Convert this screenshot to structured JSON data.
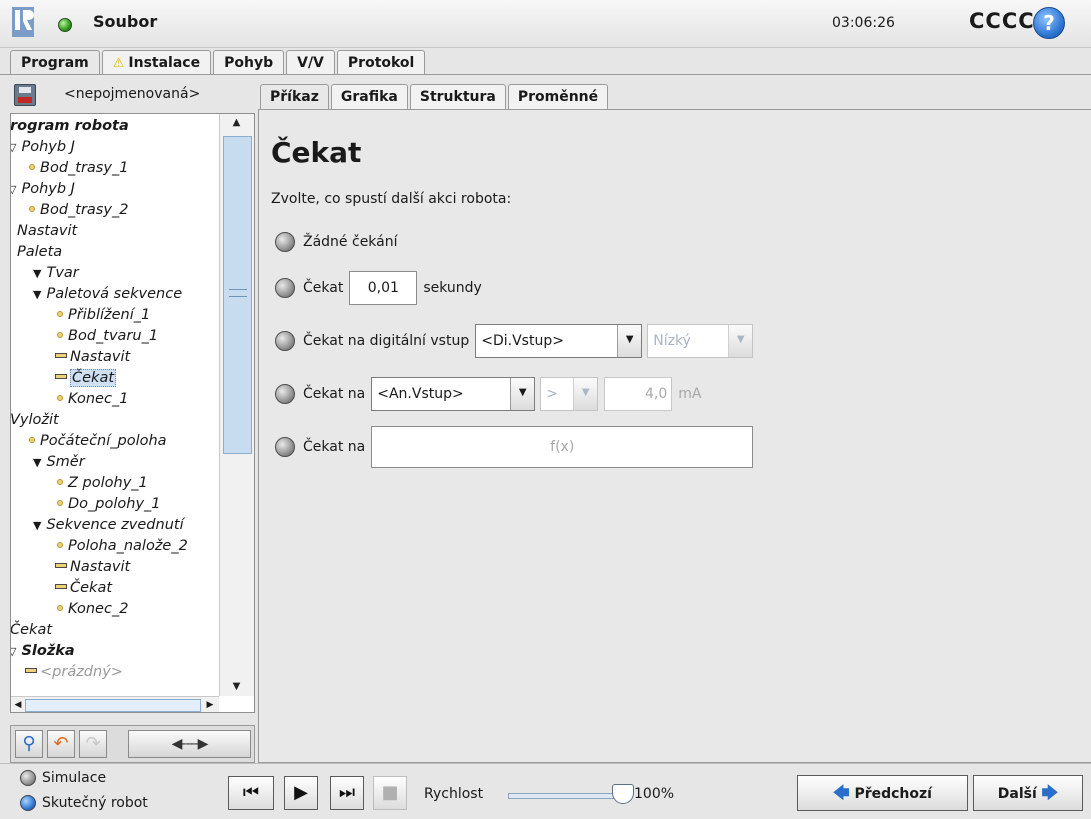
{
  "titlebar": {
    "file_menu": "Soubor",
    "clock": "03:06:26",
    "robot_name": "CCCC",
    "help": "?"
  },
  "top_tabs": [
    {
      "label": "Program"
    },
    {
      "label": "Instalace"
    },
    {
      "label": "Pohyb"
    },
    {
      "label": "V/V"
    },
    {
      "label": "Protokol"
    }
  ],
  "program": {
    "name": "<nepojmenovaná>"
  },
  "tree": [
    {
      "label": "rogram robota"
    },
    {
      "label": "Pohyb J"
    },
    {
      "label": "Bod_trasy_1"
    },
    {
      "label": "Pohyb J"
    },
    {
      "label": "Bod_trasy_2"
    },
    {
      "label": "Nastavit"
    },
    {
      "label": "Paleta"
    },
    {
      "label": "Tvar"
    },
    {
      "label": "Paletová sekvence"
    },
    {
      "label": "Přiblížení_1"
    },
    {
      "label": "Bod_tvaru_1"
    },
    {
      "label": "Nastavit"
    },
    {
      "label": "Čekat"
    },
    {
      "label": "Konec_1"
    },
    {
      "label": "Vyložit"
    },
    {
      "label": "Počáteční_poloha"
    },
    {
      "label": "Směr"
    },
    {
      "label": "Z polohy_1"
    },
    {
      "label": "Do_polohy_1"
    },
    {
      "label": "Sekvence zvednutí"
    },
    {
      "label": "Poloha_nalože_2"
    },
    {
      "label": "Nastavit"
    },
    {
      "label": "Čekat"
    },
    {
      "label": "Konec_2"
    },
    {
      "label": "Čekat"
    },
    {
      "label": "Složka"
    },
    {
      "label": "<prázdný>"
    }
  ],
  "sub_tabs": [
    {
      "label": "Příkaz"
    },
    {
      "label": "Grafika"
    },
    {
      "label": "Struktura"
    },
    {
      "label": "Proměnné"
    }
  ],
  "command": {
    "title": "Čekat",
    "instruction": "Zvolte, co spustí další akci robota:",
    "opt_none": "Žádné čekání",
    "opt_wait": "Čekat",
    "wait_value": "0,01",
    "wait_unit": "sekundy",
    "opt_digital": "Čekat na digitální vstup",
    "digital_input": "<Di.Vstup>",
    "digital_state": "Nízký",
    "opt_analog": "Čekat na",
    "analog_input": "<An.Vstup>",
    "analog_op": ">",
    "analog_value": "4,0",
    "analog_unit": "mA",
    "opt_expr": "Čekat na",
    "expr": "f(x)"
  },
  "bottom": {
    "mode_sim": "Simulace",
    "mode_real": "Skutečný robot",
    "speed_label": "Rychlost",
    "speed_value": "100%",
    "speed_fraction": 1.0,
    "prev": "Předchozí",
    "next": "Další"
  }
}
